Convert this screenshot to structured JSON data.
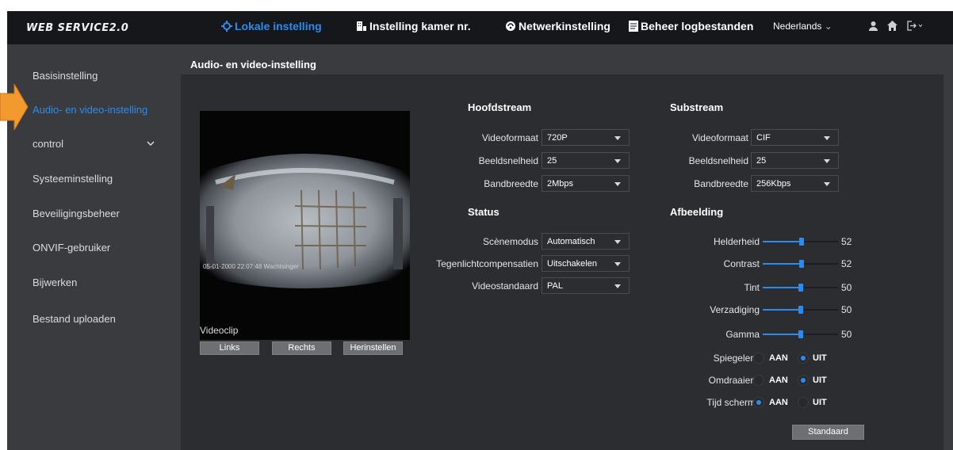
{
  "brand": "WEB SERVICE2.0",
  "nav": {
    "local": "Lokale instelling",
    "room": "Instelling kamer nr.",
    "network": "Netwerkinstelling",
    "logs": "Beheer logbestanden",
    "language": "Nederlands"
  },
  "sidebar": {
    "items": [
      {
        "label": "Basisinstelling"
      },
      {
        "label": "Audio- en video-instelling"
      },
      {
        "label": "control"
      },
      {
        "label": "Systeeminstelling"
      },
      {
        "label": "Beveiligingsbeheer"
      },
      {
        "label": "ONVIF-gebruiker"
      },
      {
        "label": "Bijwerken"
      },
      {
        "label": "Bestand uploaden"
      }
    ]
  },
  "tab": {
    "label": "Audio- en video-instelling"
  },
  "video": {
    "osd": "05-01-2000 22:07:48 Wachtsinger",
    "clip_label": "Videoclip",
    "buttons": {
      "left": "Links",
      "right": "Rechts",
      "reset": "Herinstellen"
    }
  },
  "mainstream": {
    "title": "Hoofdstream",
    "format_label": "Videoformaat",
    "format_value": "720P",
    "fps_label": "Beeldsnelheid",
    "fps_value": "25",
    "bitrate_label": "Bandbreedte",
    "bitrate_value": "2Mbps"
  },
  "substream": {
    "title": "Substream",
    "format_label": "Videoformaat",
    "format_value": "CIF",
    "fps_label": "Beeldsnelheid",
    "fps_value": "25",
    "bitrate_label": "Bandbreedte",
    "bitrate_value": "256Kbps"
  },
  "status": {
    "title": "Status",
    "scene_label": "Scènemodus",
    "scene_value": "Automatisch",
    "backlight_label": "Tegenlichtcompensatien",
    "backlight_value": "Uitschakelen",
    "standard_label": "Videostandaard",
    "standard_value": "PAL"
  },
  "image": {
    "title": "Afbeelding",
    "sliders": [
      {
        "label": "Helderheid",
        "value": 52
      },
      {
        "label": "Contrast",
        "value": 52
      },
      {
        "label": "Tint",
        "value": 50
      },
      {
        "label": "Verzadiging",
        "value": 50
      },
      {
        "label": "Gamma",
        "value": 50
      }
    ],
    "toggles": [
      {
        "label": "Spiegelen",
        "on_label": "AAN",
        "off_label": "UIT",
        "selected": "UIT"
      },
      {
        "label": "Omdraaien",
        "on_label": "AAN",
        "off_label": "UIT",
        "selected": "UIT"
      },
      {
        "label": "Tijd scherm",
        "on_label": "AAN",
        "off_label": "UIT",
        "selected": "AAN"
      }
    ],
    "default_button": "Standaard"
  },
  "colors": {
    "accent": "#2a8cf0",
    "arrow": "#f39a2e"
  }
}
